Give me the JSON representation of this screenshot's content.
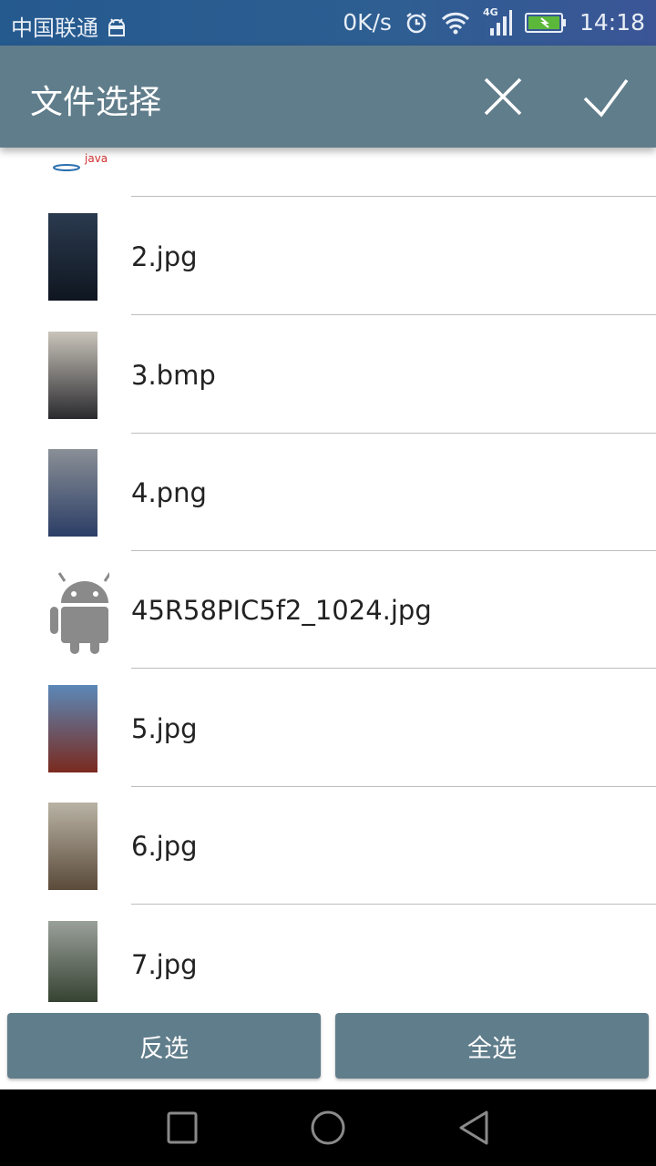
{
  "status_bar": {
    "carrier": "中国联通",
    "speed": "0K/s",
    "network": "4G",
    "time": "14:18",
    "icons": [
      "android-debug-icon",
      "alarm-icon",
      "wifi-icon",
      "signal-icon",
      "battery-charging-icon"
    ]
  },
  "header": {
    "title": "文件选择",
    "cancel_icon": "close-icon",
    "confirm_icon": "check-icon",
    "color": "#607d8b"
  },
  "files": [
    {
      "name": "2.jpg",
      "thumb": "image-thumbnail",
      "colors": [
        "#2b3a4f",
        "#0f1620"
      ]
    },
    {
      "name": "3.bmp",
      "thumb": "image-thumbnail",
      "colors": [
        "#c9c4bb",
        "#2a2a2e"
      ]
    },
    {
      "name": "4.png",
      "thumb": "image-thumbnail",
      "colors": [
        "#8a8f96",
        "#2c3e66"
      ]
    },
    {
      "name": "45R58PIC5f2_1024.jpg",
      "thumb": "android-icon"
    },
    {
      "name": "5.jpg",
      "thumb": "image-thumbnail",
      "colors": [
        "#5b88b8",
        "#7a2a1e"
      ]
    },
    {
      "name": "6.jpg",
      "thumb": "image-thumbnail",
      "colors": [
        "#b9b3a5",
        "#5a4a3a"
      ]
    },
    {
      "name": "7.jpg",
      "thumb": "image-thumbnail",
      "colors": [
        "#9aa09a",
        "#2e3b2a"
      ]
    }
  ],
  "buttons": {
    "invert": "反选",
    "select_all": "全选"
  },
  "nav": {
    "icons": [
      "recent-apps-icon",
      "home-icon",
      "back-icon"
    ]
  }
}
